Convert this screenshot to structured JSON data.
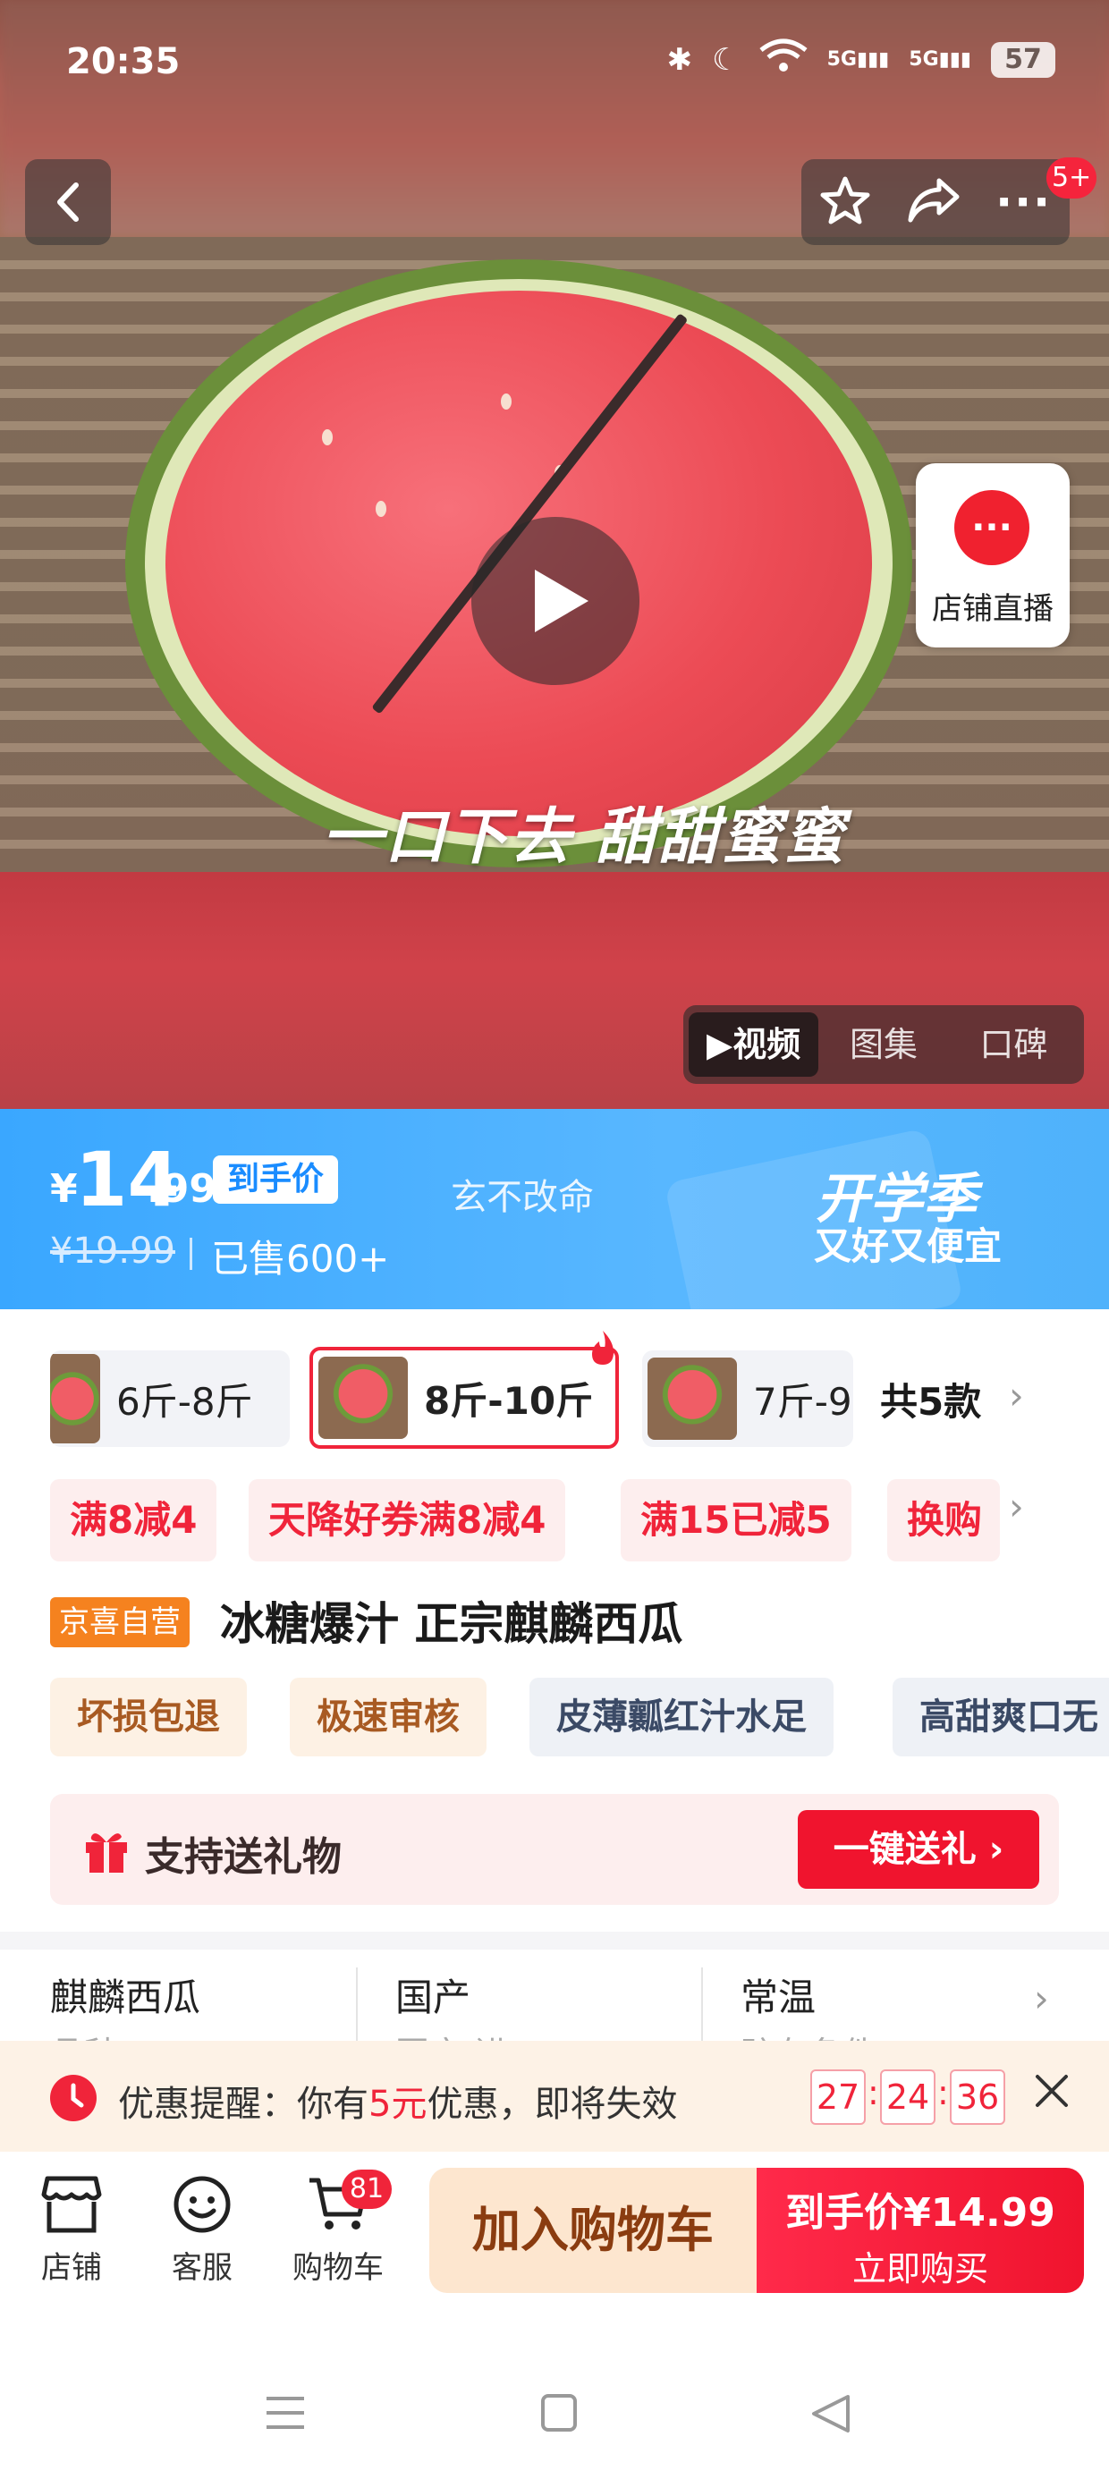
{
  "status_bar": {
    "time": "20:35",
    "network_1": "5G",
    "network_2": "5G",
    "battery": "57"
  },
  "header": {
    "notification_badge": "5+"
  },
  "media": {
    "subtitle": "一口下去 甜甜蜜蜜",
    "live": {
      "label": "店铺直播"
    },
    "tabs": [
      {
        "label": "▶视频",
        "active": true
      },
      {
        "label": "图集",
        "active": false
      },
      {
        "label": "口碑",
        "active": false
      }
    ]
  },
  "price_banner": {
    "currency": "¥",
    "price_int": "14",
    "price_dec": ".99",
    "price_tag": "到手价",
    "shop_phrase": "玄不改命",
    "old_price": "¥19.99",
    "sold": "已售600+",
    "promo_title": "开学季",
    "promo_subtitle": "又好又便宜",
    "accent_color": "#3aa7ff"
  },
  "specs": {
    "items": [
      {
        "label": "6斤-8斤"
      },
      {
        "label": "8斤-10斤",
        "selected": true
      },
      {
        "label": "7斤-9"
      }
    ],
    "total": "共5款"
  },
  "coupons": [
    "满8减4",
    "天降好券满8减4",
    "满15已减5",
    "换购"
  ],
  "product": {
    "badge": "京喜自营",
    "title": "冰糖爆汁 正宗麒麟西瓜",
    "tags": [
      "坏损包退",
      "极速审核",
      "皮薄瓤红汁水足",
      "高甜爽口无"
    ]
  },
  "gift": {
    "label": "支持送礼物",
    "button": "一键送礼"
  },
  "attributes": [
    {
      "value": "麒麟西瓜",
      "sub": "品种"
    },
    {
      "value": "国产",
      "sub": "国产/进口"
    },
    {
      "value": "常温",
      "sub": "贮存条件"
    }
  ],
  "reminder": {
    "prefix": "优惠提醒：你有",
    "amount": "5元",
    "suffix": "优惠，即将失效",
    "hours": "27",
    "minutes": "24",
    "seconds": "36"
  },
  "bottom_bar": {
    "shop": "店铺",
    "service": "客服",
    "cart": "购物车",
    "cart_count": "81",
    "add_to_cart": "加入购物车",
    "buy_line1": "到手价¥14.99",
    "buy_line2": "立即购买"
  },
  "colors": {
    "brand_red": "#f0243a",
    "banner_blue": "#3aa7ff"
  }
}
